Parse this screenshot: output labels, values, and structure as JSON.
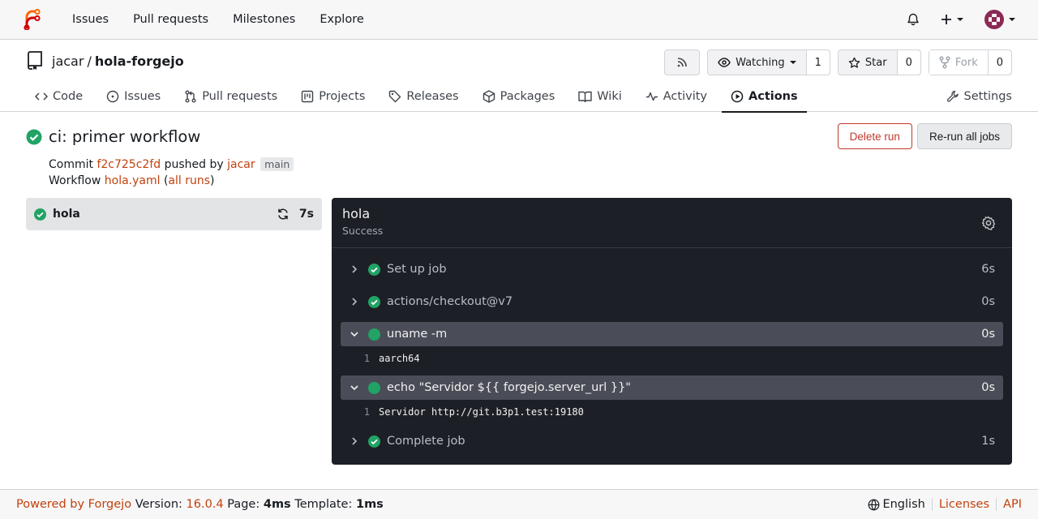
{
  "topnav": {
    "links": [
      "Issues",
      "Pull requests",
      "Milestones",
      "Explore"
    ],
    "plus_label": "+"
  },
  "repo": {
    "owner": "jacar",
    "separator": "/",
    "name": "hola-forgejo",
    "watch_label": "Watching",
    "watch_count": "1",
    "star_label": "Star",
    "star_count": "0",
    "fork_label": "Fork",
    "fork_count": "0"
  },
  "tabs": [
    {
      "label": "Code",
      "icon": "code-icon"
    },
    {
      "label": "Issues",
      "icon": "issue-icon"
    },
    {
      "label": "Pull requests",
      "icon": "pull-request-icon"
    },
    {
      "label": "Projects",
      "icon": "project-icon"
    },
    {
      "label": "Releases",
      "icon": "tag-icon"
    },
    {
      "label": "Packages",
      "icon": "package-icon"
    },
    {
      "label": "Wiki",
      "icon": "book-icon"
    },
    {
      "label": "Activity",
      "icon": "pulse-icon"
    },
    {
      "label": "Actions",
      "icon": "play-icon",
      "active": true
    },
    {
      "label": "Settings",
      "icon": "tools-icon"
    }
  ],
  "run": {
    "title": "ci: primer workflow",
    "commit_prefix": "Commit",
    "commit_sha": "f2c725c2fd",
    "pushed_by": "pushed by",
    "author": "jacar",
    "branch": "main",
    "workflow_prefix": "Workflow",
    "workflow_file": "hola.yaml",
    "open_paren": "(",
    "all_runs": "all runs",
    "close_paren": ")",
    "delete_label": "Delete run",
    "rerun_label": "Re-run all jobs"
  },
  "job": {
    "name": "hola",
    "duration": "7s",
    "status": "Success"
  },
  "steps": [
    {
      "name": "Set up job",
      "time": "6s",
      "open": false
    },
    {
      "name": "actions/checkout@v7",
      "time": "0s",
      "open": false
    },
    {
      "name": "uname -m",
      "time": "0s",
      "open": true,
      "lines": [
        {
          "n": "1",
          "text": "aarch64"
        }
      ]
    },
    {
      "name": "echo \"Servidor ${{ forgejo.server_url }}\"",
      "time": "0s",
      "open": true,
      "lines": [
        {
          "n": "1",
          "text": "Servidor http://git.b3p1.test:19180"
        }
      ]
    },
    {
      "name": "Complete job",
      "time": "1s",
      "open": false
    }
  ],
  "footer": {
    "powered": "Powered by Forgejo",
    "version_label": "Version:",
    "version": "16.0.4",
    "page_label": "Page:",
    "page_time": "4ms",
    "template_label": "Template:",
    "template_time": "1ms",
    "language": "English",
    "licenses": "Licenses",
    "api": "API"
  },
  "colors": {
    "accent": "#c2410c",
    "success": "#21a365",
    "danger": "#c0392b",
    "log_bg": "#1d1f26"
  }
}
